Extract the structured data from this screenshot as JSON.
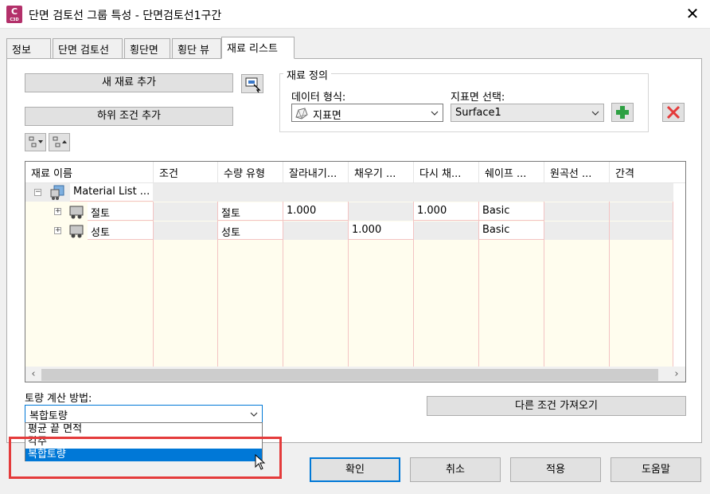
{
  "window": {
    "title": "단면 검토선 그룹 특성 - 단면검토선1구간",
    "icon_letter": "C",
    "icon_sub": "C3D",
    "close_label": "✕"
  },
  "tabs": [
    {
      "label": "정보"
    },
    {
      "label": "단면 검토선"
    },
    {
      "label": "횡단면"
    },
    {
      "label": "횡단 뷰"
    },
    {
      "label": "재료 리스트",
      "active": true
    }
  ],
  "buttons": {
    "add_material": "새 재료 추가",
    "add_subcriteria": "하위 조건 추가",
    "import_criteria": "다른 조건 가져오기"
  },
  "material_definition": {
    "legend": "재료 정의",
    "data_type_label": "데이터 형식:",
    "data_type_value": "지표면",
    "surface_label": "지표면 선택:",
    "surface_value": "Surface1"
  },
  "grid": {
    "columns": [
      "재료 이름",
      "조건",
      "수량 유형",
      "잘라내기...",
      "채우기 ...",
      "다시 채...",
      "쉐이프 ...",
      "원곡선 ...",
      "간격"
    ],
    "root": "Material List ...",
    "rows": [
      {
        "name": "절토",
        "quantity_type": "절토",
        "cut": "1.000",
        "fill": "",
        "refill": "1.000",
        "shape": "Basic"
      },
      {
        "name": "성토",
        "quantity_type": "성토",
        "cut": "",
        "fill": "1.000",
        "refill": "",
        "shape": "Basic"
      }
    ]
  },
  "volume_method": {
    "label": "토량 계산 방법:",
    "selected": "복합토량",
    "options": [
      "평균 끝 면적",
      "각주",
      "복합토량"
    ]
  },
  "footer": {
    "ok": "확인",
    "cancel": "취소",
    "apply": "적용",
    "help": "도움말"
  },
  "colors": {
    "accent": "#0078d7",
    "highlight": "#e43b3b",
    "grid_background": "#fffdee"
  }
}
